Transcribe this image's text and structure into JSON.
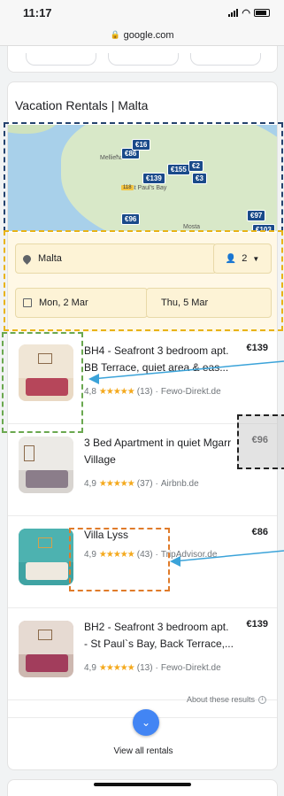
{
  "status_bar": {
    "time": "11:17"
  },
  "url_bar": {
    "domain": "google.com"
  },
  "card": {
    "title": "Vacation Rentals | Malta"
  },
  "map": {
    "labels": [
      "Mellieħa",
      "St Paul's Bay",
      "Mosta"
    ],
    "road_tag": "118",
    "price_tags": [
      "€86",
      "€16",
      "€155",
      "€139",
      "€2",
      "€3",
      "€96",
      "€97",
      "€103"
    ]
  },
  "filters": {
    "location": "Malta",
    "guests": "2",
    "check_in": "Mon, 2 Mar",
    "check_out": "Thu, 5 Mar"
  },
  "listings": [
    {
      "title": "BH4 - Seafront 3 bedroom apt. BB Terrace, quiet area & eas...",
      "price": "€139",
      "rating": "4,8",
      "stars": "★★★★★",
      "reviews": "(13)",
      "source": "Fewo-Direkt.de"
    },
    {
      "title": "3 Bed Apartment in quiet Mgarr Village",
      "price": "€96",
      "rating": "4,9",
      "stars": "★★★★★",
      "reviews": "(37)",
      "source": "Airbnb.de"
    },
    {
      "title": "Villa Lyss",
      "price": "€86",
      "rating": "4,9",
      "stars": "★★★★★",
      "reviews": "(43)",
      "source": "TripAdvisor.de"
    },
    {
      "title": "BH2 - Seafront 3 bedroom apt. - St Paul`s Bay, Back Terrace,...",
      "price": "€139",
      "rating": "4,9",
      "stars": "★★★★★",
      "reviews": "(13)",
      "source": "Fewo-Direkt.de"
    }
  ],
  "footer": {
    "about": "About these results",
    "view_all": "View all rentals"
  },
  "icons": {
    "location": "pin-icon",
    "guests": "person-icon",
    "calendar": "calendar-icon",
    "expand": "chevron-down-icon",
    "info": "info-icon"
  },
  "colors": {
    "accent_blue": "#4285f4",
    "map_price_tag": "#1a4a8a",
    "star": "#f4a91d",
    "filter_bg": "#fff8e6"
  }
}
